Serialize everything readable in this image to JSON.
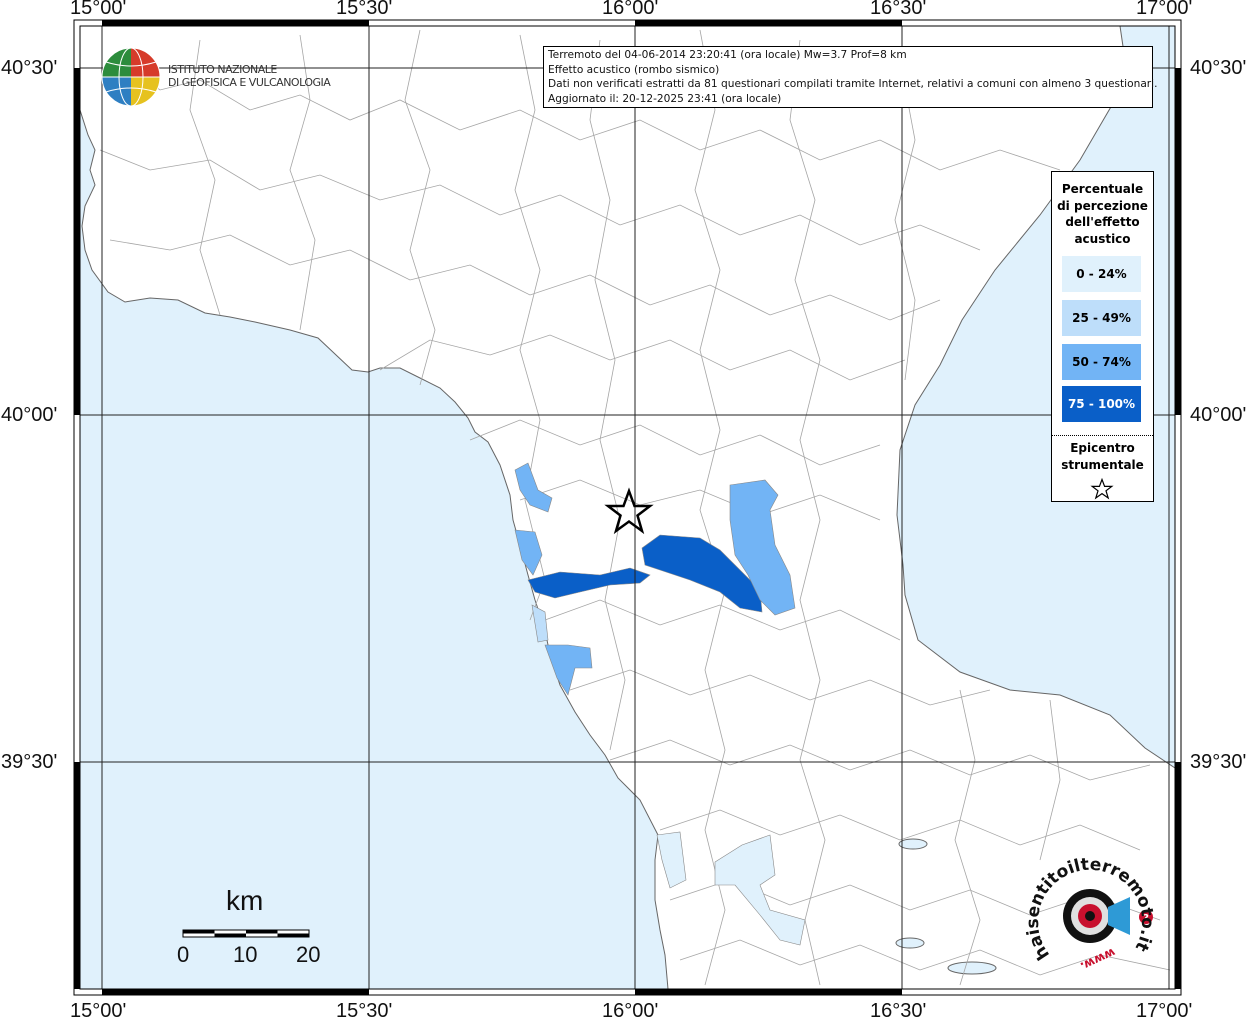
{
  "map": {
    "lon_labels": [
      "15°00'",
      "15°30'",
      "16°00'",
      "16°30'",
      "17°00'"
    ],
    "lat_labels": [
      "40°30'",
      "40°00'",
      "39°30'"
    ],
    "colors": {
      "sea": "#e0f1fc",
      "land": "#ffffff",
      "border": "#9a9a9a",
      "grid": "#222222"
    }
  },
  "info": {
    "line1": "Terremoto del 04-06-2014 23:20:41 (ora locale) Mw=3.7 Prof=8 km",
    "line2": "Effetto acustico (rombo sismico)",
    "line3": "Dati non verificati estratti da 81 questionari compilati tramite Internet, relativi a comuni con almeno 3 questionari.",
    "line4": "Aggiornato il: 20-12-2025 23:41 (ora locale)"
  },
  "logo": {
    "line1": "ISTITUTO NAZIONALE",
    "line2": "DI GEOFISICA E VULCANOLOGIA",
    "icon": "ingv-globe-icon"
  },
  "legend": {
    "title": "Percentuale\ndi percezione\ndell'effetto\nacustico",
    "classes": [
      {
        "label": "0 - 24%",
        "color": "#e0f1fc",
        "text_color": "#000000"
      },
      {
        "label": "25 - 49%",
        "color": "#bedefa",
        "text_color": "#000000"
      },
      {
        "label": "50 - 74%",
        "color": "#72b4f5",
        "text_color": "#000000"
      },
      {
        "label": "75 - 100%",
        "color": "#0a5fc8",
        "text_color": "#ffffff"
      }
    ],
    "epicenter_label": "Epicentro\nstrumentale",
    "epicenter_icon": "star-icon"
  },
  "scalebar": {
    "title": "km",
    "ticks": [
      "0",
      "10",
      "20"
    ]
  },
  "watermark": {
    "text": "haisentitoilterremoto.it",
    "url_text": "www.",
    "icon": "target-megaphone-icon"
  }
}
